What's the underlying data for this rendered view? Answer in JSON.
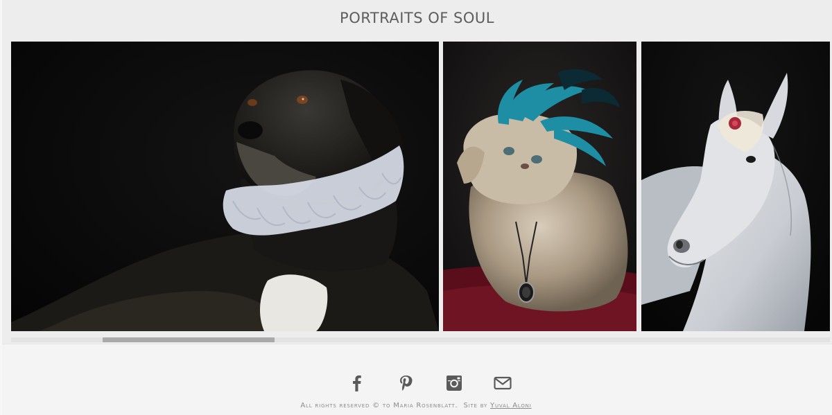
{
  "header": {
    "title": "PORTRAITS OF SOUL"
  },
  "gallery": {
    "photos": [
      {
        "name": "dog-portrait",
        "subject": "Black dog wearing white ruffled collar"
      },
      {
        "name": "cat-portrait",
        "subject": "Persian cat with teal feather headdress and pendant"
      },
      {
        "name": "horse-portrait",
        "subject": "White horse with flower on forehead"
      }
    ],
    "scroll_position_fraction": 0.11
  },
  "footer": {
    "social_icons": [
      "facebook-icon",
      "pinterest-icon",
      "instagram-icon",
      "email-icon"
    ],
    "copyright_text": "All rights reserved © to Maria Rosenblatt.",
    "site_by_label": "Site by",
    "site_by_link": "Yuval Aloni"
  },
  "colors": {
    "background": "#ededed",
    "title": "#5d5d5d",
    "icons": "#5a5a5a",
    "scroll_thumb": "#a9a9a9"
  }
}
